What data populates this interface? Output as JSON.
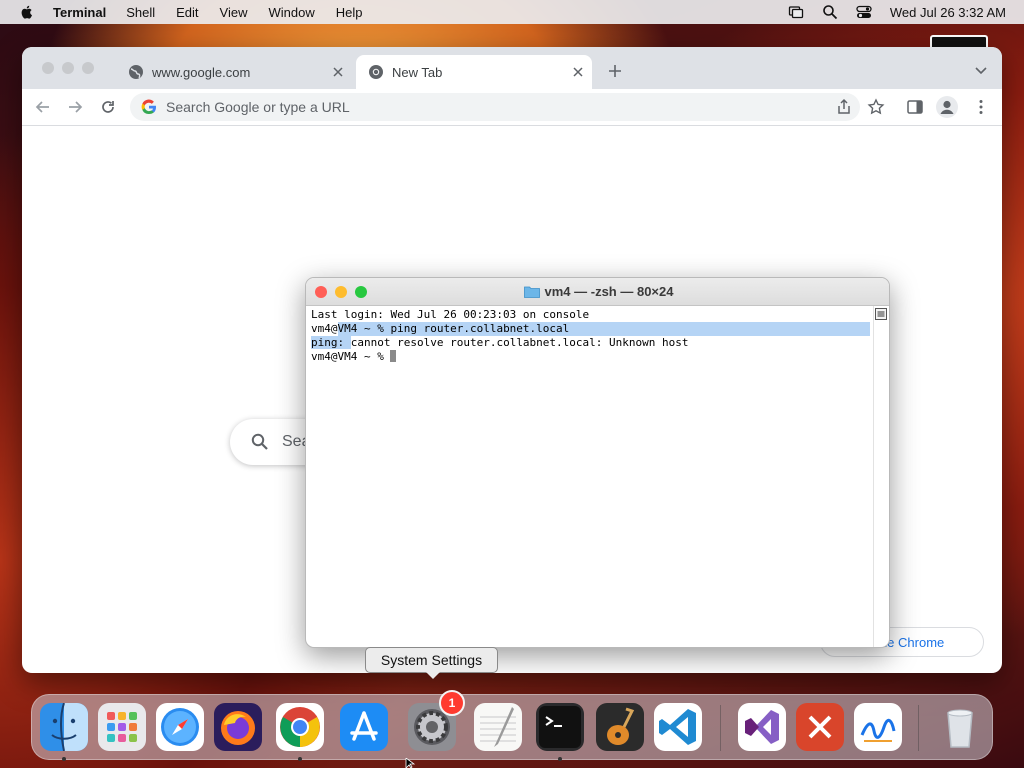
{
  "menubar": {
    "app_name": "Terminal",
    "items": [
      "Shell",
      "Edit",
      "View",
      "Window",
      "Help"
    ],
    "datetime": "Wed Jul 26  3:32 AM"
  },
  "chrome": {
    "tabs": [
      {
        "label": "www.google.com",
        "active": false
      },
      {
        "label": "New Tab",
        "active": true
      }
    ],
    "omnibox": {
      "placeholder": "Search Google or type a URL",
      "value": ""
    },
    "ntp_search_text": "Sea",
    "customize_label": "omize Chrome"
  },
  "terminal": {
    "title": "vm4 — -zsh — 80×24",
    "lines": {
      "line0": "Last login: Wed Jul 26 00:23:03 on console",
      "line1_a": "vm4@",
      "line1_b": "VM4 ~ % ping router.collabnet.local",
      "line2_a": "ping: ",
      "line2_b": "cannot resolve router.collabnet.local: Unknown host",
      "line3": "vm4@VM4 ~ % "
    }
  },
  "tooltip": {
    "label": "System Settings"
  },
  "dock": {
    "apps": [
      "Finder",
      "Launchpad",
      "Safari",
      "Firefox",
      "Google Chrome",
      "App Store",
      "System Settings",
      "TextEdit",
      "Terminal",
      "GarageBand",
      "Visual Studio Code",
      "Visual Studio",
      "Remote Desktop",
      "Freeform",
      "Trash"
    ],
    "badge_count": "1"
  },
  "colors": {
    "accent_blue": "#1a73e8",
    "term_selection": "#b5d4f5",
    "badge_red": "#ff3b30"
  }
}
